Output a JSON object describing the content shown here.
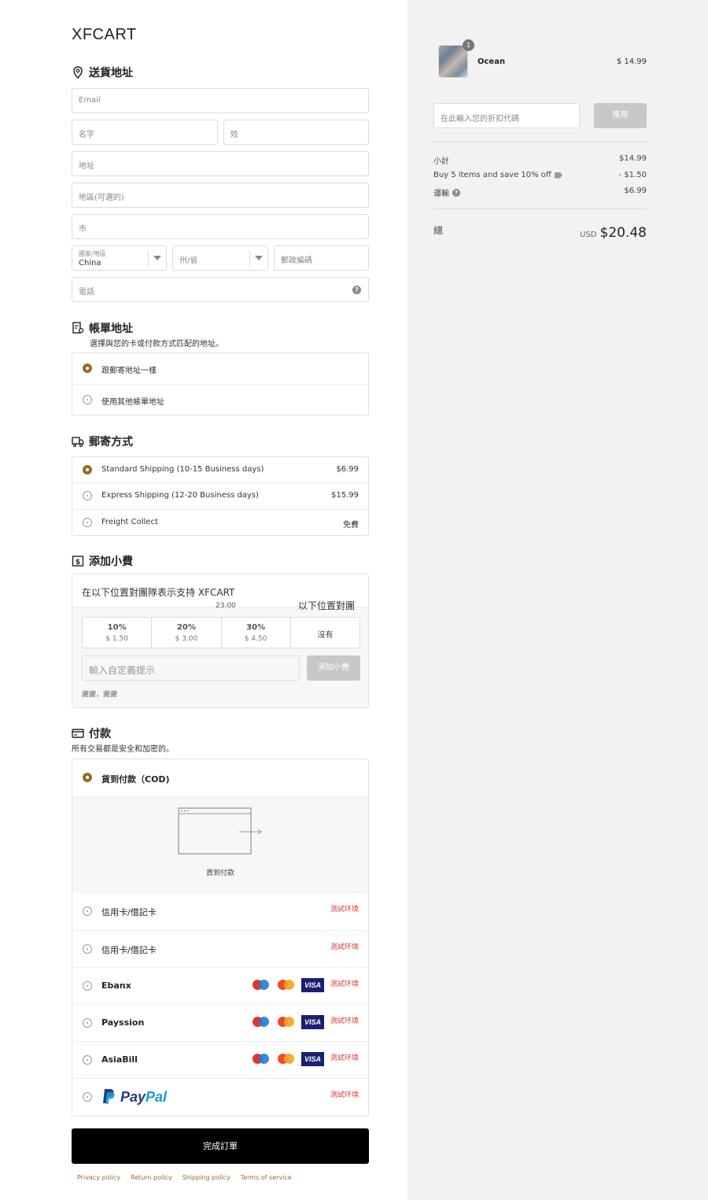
{
  "brand": "XFCART",
  "shipping_address": {
    "title": "送貨地址",
    "email_placeholder": "Email",
    "first_name_placeholder": "名字",
    "last_name_placeholder": "姓",
    "address_placeholder": "地址",
    "address2_placeholder": "地區(可選的)",
    "city_placeholder": "市",
    "country_label": "國家/地區",
    "country_value": "China",
    "state_placeholder": "州/省",
    "zip_placeholder": "郵政編碼",
    "phone_placeholder": "電話"
  },
  "billing": {
    "title": "帳單地址",
    "subtitle": "選擇與您的卡或付款方式匹配的地址。",
    "options": [
      {
        "label": "跟郵寄地址一樣",
        "selected": true
      },
      {
        "label": "使用其他帳單地址",
        "selected": false
      }
    ]
  },
  "shipping_method": {
    "title": "郵寄方式",
    "options": [
      {
        "label": "Standard Shipping (10-15 Business days)",
        "price": "$6.99",
        "selected": true
      },
      {
        "label": "Express Shipping (12-20 Business days)",
        "price": "$15.99",
        "selected": false
      },
      {
        "label": "Freight Collect",
        "price": "免費",
        "selected": false
      }
    ]
  },
  "tip": {
    "title": "添加小費",
    "message": "在以下位置對團隊表示支持 XFCART",
    "fragment_amount": "23.00",
    "fragment_text": "以下位置對團",
    "options": [
      {
        "pct": "10%",
        "amount": "$ 1.50"
      },
      {
        "pct": "20%",
        "amount": "$ 3.00"
      },
      {
        "pct": "30%",
        "amount": "$ 4.50"
      }
    ],
    "none_label": "沒有",
    "custom_placeholder": "輸入自定義提示",
    "add_button": "添加小費",
    "thanks": "謝謝，謝謝"
  },
  "payment": {
    "title": "付款",
    "subtitle": "所有交易都是安全和加密的。",
    "cod_label": "貨到付款（COD)",
    "cod_caption": "貨到付款",
    "test_label": "測試环境",
    "methods": [
      {
        "label": "信用卡/借記卡"
      },
      {
        "label": "信用卡/借記卡"
      },
      {
        "label": "Ebanx"
      },
      {
        "label": "Payssion"
      },
      {
        "label": "AsiaBill"
      }
    ],
    "paypal_pay": "Pay",
    "paypal_pal": "Pal",
    "visa": "VISA"
  },
  "submit_label": "完成訂單",
  "footer_links": [
    "Privacy policy",
    "Return policy",
    "Shipping policy",
    "Terms of service"
  ],
  "summary": {
    "product_name": "Ocean",
    "product_qty": "1",
    "product_price": "$ 14.99",
    "discount_placeholder": "在此輸入您的折扣代碼",
    "apply_button": "應用",
    "subtotal_label": "小計",
    "subtotal_value": "$14.99",
    "discount_label": "Buy 5 items and save 10% off",
    "discount_value": "- $1.50",
    "shipping_label": "運輸",
    "shipping_value": "$6.99",
    "total_label": "總",
    "total_currency": "USD",
    "total_value": "$20.48"
  },
  "colors": {
    "accent": "#9a6a2a",
    "test_red": "#e03a3a",
    "right_bg": "#f2f2f2"
  }
}
